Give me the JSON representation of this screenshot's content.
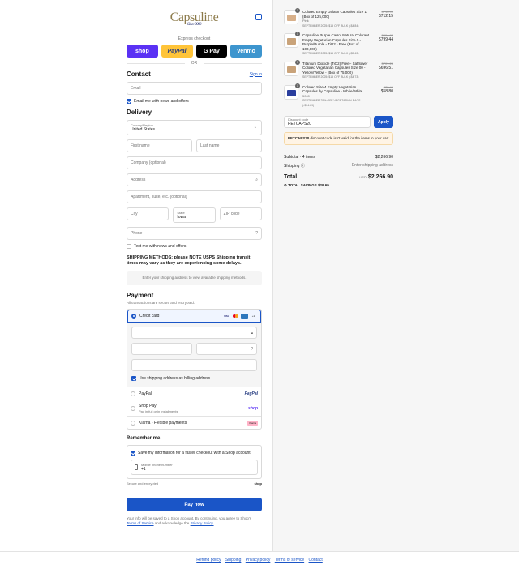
{
  "header": {
    "logo": "Capsuline",
    "logo_sub": "Since 2003"
  },
  "express": {
    "label": "Express checkout",
    "wallets": [
      "shop",
      "PayPal",
      "G Pay",
      "venmo"
    ],
    "or": "OR"
  },
  "contact": {
    "title": "Contact",
    "sign_in": "Sign in",
    "email_placeholder": "Email",
    "news_label": "Email me with news and offers"
  },
  "delivery": {
    "title": "Delivery",
    "country_label": "Country/Region",
    "country_value": "United States",
    "first_name": "First name",
    "last_name": "Last name",
    "company": "Company (optional)",
    "address": "Address",
    "apartment": "Apartment, suite, etc. (optional)",
    "city": "City",
    "state_label": "State",
    "state_value": "Iowa",
    "zip": "ZIP code",
    "phone": "Phone",
    "text_label": "Text me with news and offers"
  },
  "shipping": {
    "note": "SHIPPING METHODS: please NOTE USPS Shipping transit times may vary as they are experiencing some delays.",
    "placeholder": "Enter your shipping address to view available shipping methods."
  },
  "payment": {
    "title": "Payment",
    "subtitle": "All transactions are secure and encrypted.",
    "credit_card": "Credit card",
    "more_cards": "+1",
    "billing_label": "Use shipping address as billing address",
    "paypal": "PayPal",
    "shop_pay": "Shop Pay",
    "shop_pay_sub": "Pay in full or in installments",
    "klarna": "Klarna - Flexible payments",
    "brand_paypal": "PayPal",
    "brand_shop": "shop",
    "brand_klarna": "Klarna"
  },
  "remember": {
    "title": "Remember me",
    "save_label": "Save my information for a faster checkout with a Shop account",
    "phone_label": "Mobile phone number",
    "phone_value": "+1",
    "secure": "Secure and encrypted",
    "shop": "shop"
  },
  "pay_now": "Pay now",
  "legal": {
    "text": "Your info will be saved to a Shop account. By continuing, you agree to Shop's",
    "terms": "Terms of Service",
    "and": "and acknowledge the",
    "privacy": "Privacy Policy."
  },
  "footer": {
    "links": [
      "Refund policy",
      "Shipping",
      "Privacy policy",
      "Terms of service",
      "Contact"
    ]
  },
  "cart": {
    "items": [
      {
        "qty": "1",
        "name": "Colored Empty Gelatin Capsules Size 1 (Box of 125,000)",
        "variant": "Pink",
        "discount": "SEPTEMBER 2025: $15 OFF BULK (-$4.84)",
        "old": "$716.99",
        "price": "$712.15",
        "color": "#d8b08a"
      },
      {
        "qty": "1",
        "name": "Capsuline Purple Carrot Natural Colorant Empty Vegetarian Capsules Size 0 - Purple/Purple - TiO2 - Free (Box of 100,000)",
        "variant": "",
        "discount": "SEPTEMBER 2025: $15 OFF BULK (-$5.43)",
        "old": "$804.87",
        "price": "$799.44",
        "color": "#c9a37a"
      },
      {
        "qty": "1",
        "name": "Titanium Dioxide (TiO2) Free - Safflower Colored Vegetarian Capsules Size 00 - Yellow/Yellow - (Box of 75,000)",
        "variant": "",
        "discount": "SEPTEMBER 2025: $15 OFF BULK (-$4.73)",
        "old": "$701.24",
        "price": "$696.51",
        "color": "#c9a37a"
      },
      {
        "qty": "1",
        "name": "Colored Size 4 Empty Vegetarian Capsules by Capsuline - White/White",
        "variant": "5000",
        "discount": "SEPTEMBER 25% OFF VEGETARIAN BAGS (-$14.69)",
        "old": "$73.49",
        "price": "$58.80",
        "color": "#2b3f9e"
      }
    ],
    "discount_label": "Discount code",
    "discount_value": "PETCAPS20",
    "apply": "Apply",
    "alert_code": "PETCAPS20",
    "alert_text": "discount code isn't valid for the items in your cart",
    "subtotal_label": "Subtotal · 4 items",
    "subtotal": "$2,266.90",
    "shipping_label": "Shipping",
    "shipping_value": "Enter shipping address",
    "total_label": "Total",
    "currency": "USD",
    "total": "$2,266.90",
    "savings_label": "TOTAL SAVINGS",
    "savings": "$29.69"
  },
  "colors": {
    "accent": "#1a55c7",
    "shop": "#5a31f4",
    "paypal": "#ffc439",
    "venmo": "#3d95ce"
  }
}
